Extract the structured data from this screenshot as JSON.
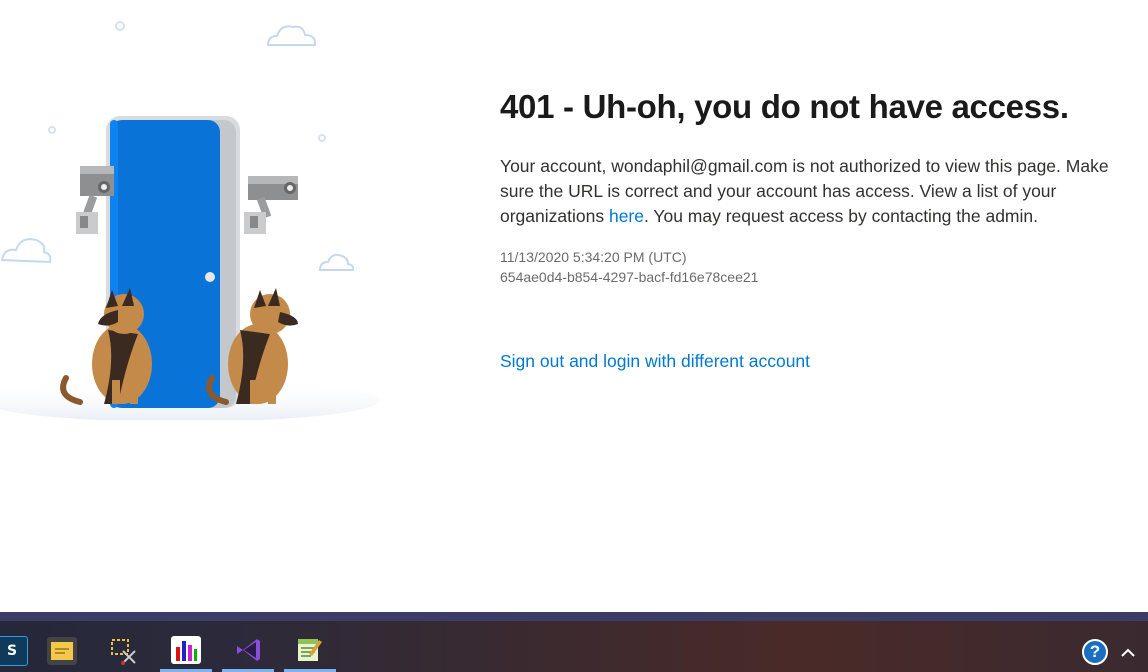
{
  "error": {
    "title": "401 - Uh-oh, you do not have access.",
    "message_prefix": "Your account, wondaphil@gmail.com is not authorized to view this page. Make sure the URL is correct and your account has access. View a list of your organizations ",
    "here_link": "here",
    "message_suffix": ". You may request access by contacting the admin.",
    "timestamp": "11/13/2020 5:34:20 PM (UTC)",
    "activity_id": "654ae0d4-b854-4297-bacf-fd16e78cee21",
    "signout_link": "Sign out and login with different account"
  },
  "taskbar": {
    "items": [
      {
        "label": "S",
        "icon": "app-s-icon",
        "active": false
      },
      {
        "label": "sticky-notes-icon",
        "icon": "sticky-notes-icon",
        "active": false
      },
      {
        "label": "snipping-tool-icon",
        "icon": "snipping-tool-icon",
        "active": false
      },
      {
        "label": "performance-monitor-icon",
        "icon": "performance-monitor-icon",
        "active": true
      },
      {
        "label": "visual-studio-icon",
        "icon": "visual-studio-icon",
        "active": true
      },
      {
        "label": "notepad-plus-icon",
        "icon": "notepad-plus-icon",
        "active": true
      }
    ],
    "tray_help": "?"
  },
  "colors": {
    "link": "#0078d4",
    "door": "#0a73d8",
    "taskbar_accent": "#3b3d66"
  }
}
